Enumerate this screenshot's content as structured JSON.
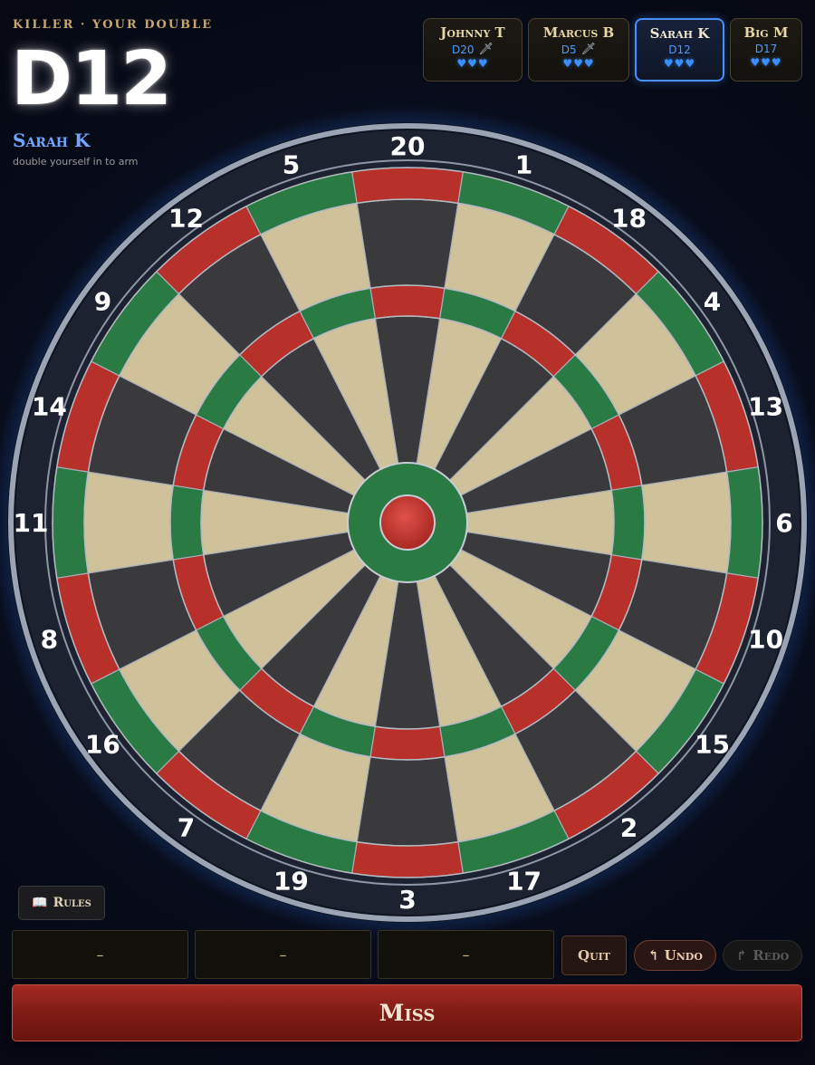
{
  "header": {
    "mode_title": "KILLER · YOUR DOUBLE",
    "target_double": "D12",
    "current_player": "Sarah K",
    "hint": "double yourself in to arm"
  },
  "players": [
    {
      "name": "Johnny T",
      "double": "D20",
      "killer": true,
      "lives": "♥♥♥",
      "active": false
    },
    {
      "name": "Marcus B",
      "double": "D5",
      "killer": true,
      "lives": "♥♥♥",
      "active": false
    },
    {
      "name": "Sarah K",
      "double": "D12",
      "killer": false,
      "lives": "♥♥♥",
      "active": true
    },
    {
      "name": "Big M",
      "double": "D17",
      "killer": false,
      "lives": "♥♥♥",
      "active": false
    }
  ],
  "board": {
    "numbers": [
      20,
      1,
      18,
      4,
      13,
      6,
      10,
      15,
      2,
      17,
      3,
      19,
      7,
      16,
      8,
      11,
      14,
      9,
      12,
      5
    ],
    "colors": {
      "single_dark": "#3a3a3c",
      "single_light": "#cfc29a",
      "ring_red": "#b7302a",
      "ring_green": "#2a7a44",
      "bull_outer": "#2a7a44",
      "bull_inner": "#c0302a",
      "surround": "#1c2230",
      "rim": "#9aa4b4"
    }
  },
  "controls": {
    "rules_icon": "book-icon",
    "rules_label": "Rules",
    "throw_slots": [
      "–",
      "–",
      "–"
    ],
    "quit_label": "Quit",
    "undo_label": "Undo",
    "redo_label": "Redo",
    "miss_label": "Miss"
  }
}
